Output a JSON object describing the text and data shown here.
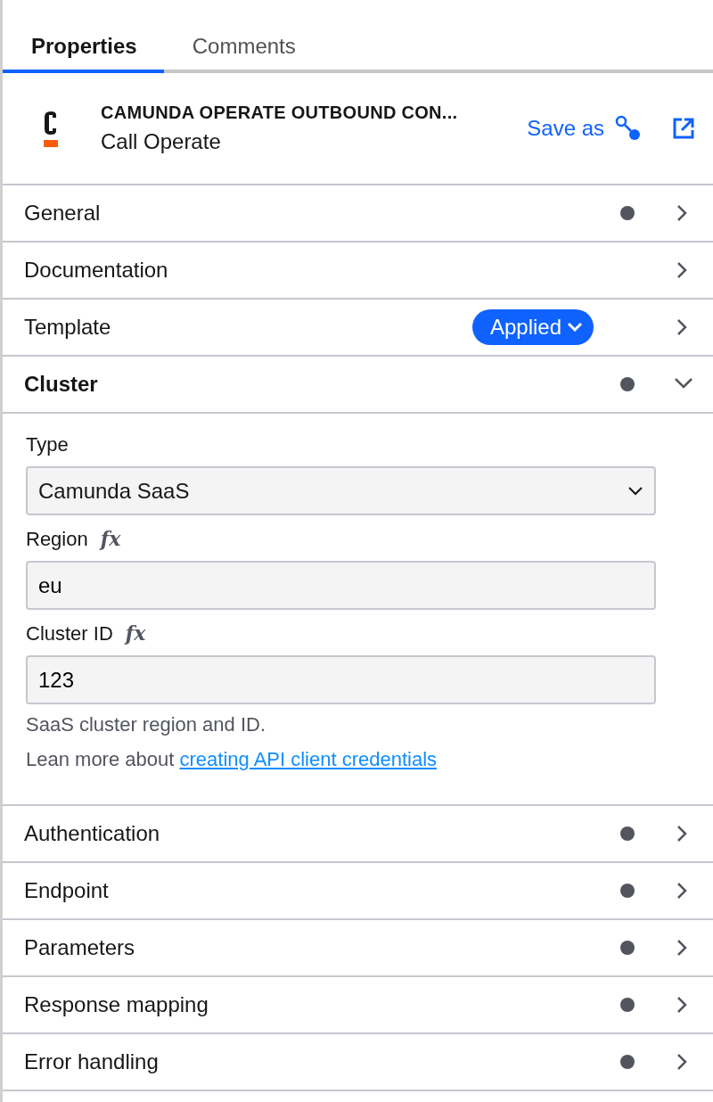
{
  "tabs": [
    {
      "label": "Properties",
      "selected": true
    },
    {
      "label": "Comments",
      "selected": false
    }
  ],
  "header": {
    "title": "CAMUNDA OPERATE OUTBOUND CON...",
    "subtitle": "Call Operate",
    "save_label": "Save as"
  },
  "groups": [
    {
      "name": "General",
      "has_entries": true,
      "expanded": false
    },
    {
      "name": "Documentation",
      "has_entries": false,
      "expanded": false
    },
    {
      "name": "Template",
      "has_entries": false,
      "expanded": false,
      "badge": "Applied"
    },
    {
      "name": "Cluster",
      "has_entries": true,
      "expanded": true,
      "fields": [
        {
          "kind": "select",
          "label": "Type",
          "value": "Camunda SaaS"
        },
        {
          "kind": "text",
          "label": "Region",
          "feel": "fx",
          "value": "eu"
        },
        {
          "kind": "text",
          "label": "Cluster ID",
          "feel": "fx",
          "value": "123"
        }
      ],
      "help": [
        {
          "text": "SaaS cluster region and ID."
        },
        {
          "text": "Lean more about ",
          "link": "creating API client credentials"
        }
      ]
    },
    {
      "name": "Authentication",
      "has_entries": true,
      "expanded": false
    },
    {
      "name": "Endpoint",
      "has_entries": true,
      "expanded": false
    },
    {
      "name": "Parameters",
      "has_entries": true,
      "expanded": false
    },
    {
      "name": "Response mapping",
      "has_entries": true,
      "expanded": false
    },
    {
      "name": "Error handling",
      "has_entries": true,
      "expanded": false
    }
  ]
}
